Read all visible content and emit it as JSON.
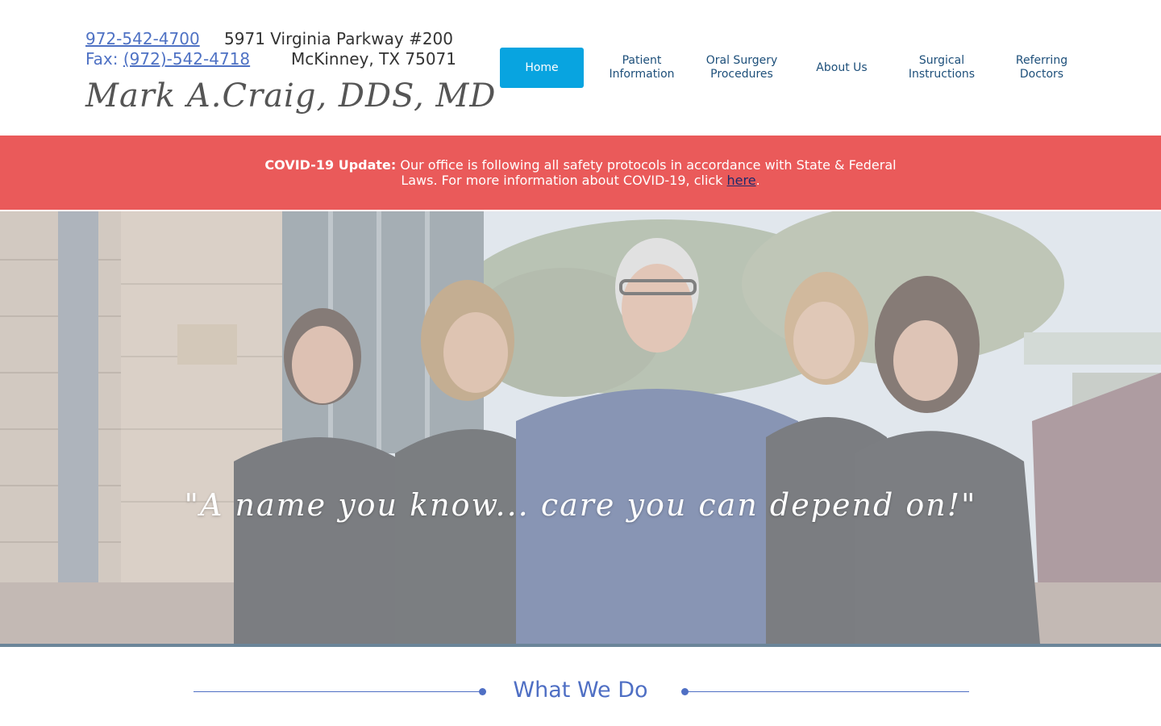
{
  "header": {
    "phone": "972-542-4700",
    "fax_label": "Fax: ",
    "fax_number": "(972)-542-4718",
    "address_line1": "5971 Virginia Parkway #200",
    "address_line2": "McKinney, TX 75071",
    "doctor_name": "Mark A.Craig, DDS, MD"
  },
  "nav": {
    "items": [
      {
        "label": "Home",
        "active": true
      },
      {
        "label": "Patient\nInformation"
      },
      {
        "label": "Oral Surgery\nProcedures"
      },
      {
        "label": "About Us"
      },
      {
        "label": "Surgical\nInstructions"
      },
      {
        "label": "Referring\nDoctors"
      }
    ]
  },
  "banner": {
    "bold": "COVID-19 Update:",
    "text": " Our office is following all safety protocols in accordance with State & Federal Laws. For more information about COVID-19, click ",
    "link": "here",
    "end": "."
  },
  "hero": {
    "quote": "\"A name you know... care you can depend on!\""
  },
  "section": {
    "title": "What We Do"
  },
  "colors": {
    "accent": "#08a4e0",
    "banner": "#ea5a5a",
    "link": "#4f72c4",
    "nav_text": "#1d4f7a",
    "heading": "#4f6fc4"
  }
}
